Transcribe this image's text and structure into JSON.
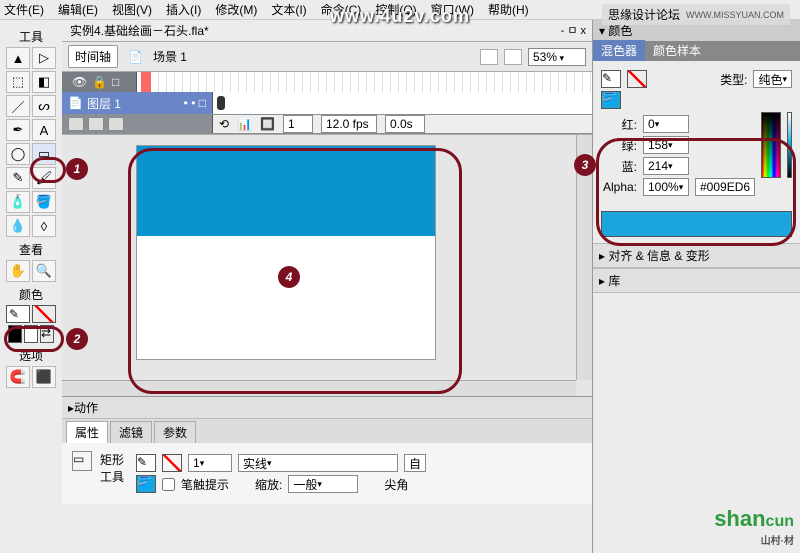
{
  "menu": [
    "文件(E)",
    "编辑(E)",
    "视图(V)",
    "插入(I)",
    "修改(M)",
    "文本(I)",
    "命令(C)",
    "控制(Q)",
    "窗口(W)",
    "帮助(H)"
  ],
  "watermarks": {
    "url": "www.4u2v.com",
    "forum": "思缘设计论坛",
    "forum_url": "WWW.MISSYUAN.COM",
    "brand_a": "shan",
    "brand_b": "cun",
    "brand_sub": "山村·材"
  },
  "tools": {
    "label": "工具",
    "view_label": "查看",
    "color_label": "颜色",
    "options_label": "选项"
  },
  "document": {
    "tab": "实例4.基础绘画－石头.fla*",
    "ctrl": "- ㅁ x",
    "timeline_btn": "时间轴",
    "scene_icon": "⯊",
    "scene": "场景 1",
    "zoom": "53%",
    "layer": "图层 1",
    "frame": "1",
    "fps": "12.0 fps",
    "elapsed": "0.0s"
  },
  "badges": {
    "b1": "1",
    "b2": "2",
    "b3": "3",
    "b4": "4"
  },
  "panels": {
    "color_title": "▾ 颜色",
    "tab_mixer": "混色器",
    "tab_swatch": "颜色样本",
    "type_label": "类型:",
    "type_value": "纯色",
    "r_label": "红:",
    "r_val": "0",
    "g_label": "绿:",
    "g_val": "158",
    "b_label": "蓝:",
    "b_val": "214",
    "alpha_label": "Alpha:",
    "alpha_val": "100%",
    "hex": "#009ED6",
    "align": "对齐 & 信息 & 变形",
    "library": "库"
  },
  "bottom": {
    "actions": "动作",
    "tab_props": "属性",
    "tab_filters": "滤镜",
    "tab_params": "参数",
    "shape": "矩形",
    "tool": "工具",
    "stroke_w": "1",
    "stroke_style": "实线",
    "custom": "自",
    "hint": "笔触提示",
    "scale_label": "缩放:",
    "scale_val": "一般",
    "cap": "尖角"
  }
}
